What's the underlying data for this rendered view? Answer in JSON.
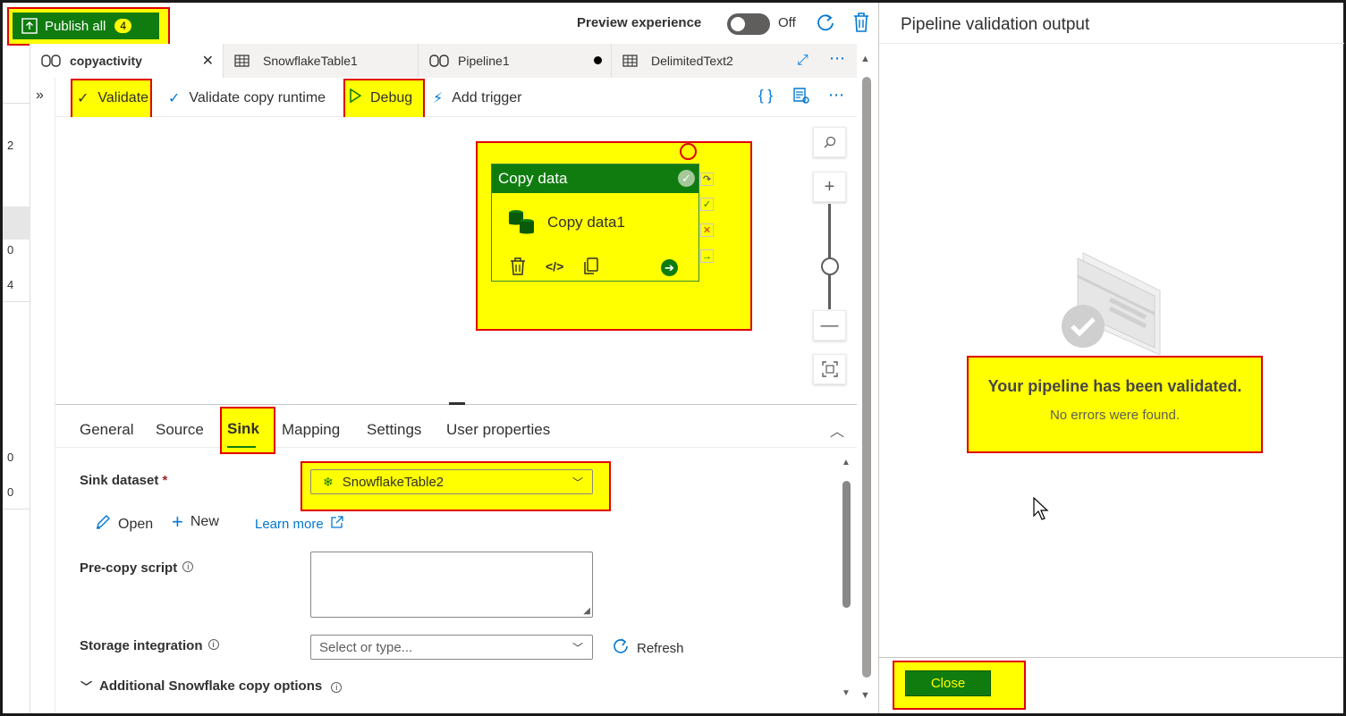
{
  "topbar": {
    "publish_label": "Publish all",
    "publish_count": "4",
    "preview_label": "Preview experience",
    "toggle_state": "Off"
  },
  "left_strip": {
    "values": [
      "2",
      "0",
      "4",
      "0",
      "0"
    ]
  },
  "tabs": [
    {
      "label": "copyactivity",
      "active": true
    },
    {
      "label": "SnowflakeTable1"
    },
    {
      "label": "Pipeline1",
      "unsaved": true
    },
    {
      "label": "DelimitedText2"
    }
  ],
  "toolbar": {
    "validate": "Validate",
    "validate_runtime": "Validate copy runtime",
    "debug": "Debug",
    "add_trigger": "Add trigger"
  },
  "activity": {
    "type_label": "Copy data",
    "name": "Copy data1"
  },
  "props": {
    "tabs": [
      "General",
      "Source",
      "Sink",
      "Mapping",
      "Settings",
      "User properties"
    ],
    "selected_tab": "Sink",
    "sink_dataset_label": "Sink dataset",
    "required_mark": "*",
    "sink_dataset_value": "SnowflakeTable2",
    "open_label": "Open",
    "new_label": "New",
    "learn_more_label": "Learn more",
    "precopy_label": "Pre-copy script",
    "storage_label": "Storage integration",
    "storage_placeholder": "Select or type...",
    "refresh_label": "Refresh",
    "additional_label": "Additional Snowflake copy options"
  },
  "validation_panel": {
    "title": "Pipeline validation output",
    "message_title": "Your pipeline has been validated.",
    "message_sub": "No errors were found.",
    "close_label": "Close"
  },
  "colors": {
    "brand_green": "#107c10",
    "highlight": "#ffff00",
    "highlight_border": "#e00000",
    "accent_blue": "#0078d4"
  }
}
